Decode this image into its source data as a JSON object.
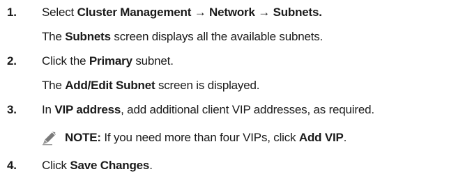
{
  "steps": [
    {
      "number": "1.",
      "main": {
        "prefix": "Select ",
        "path1": "Cluster Management",
        "arrow1": " → ",
        "path2": "Network",
        "arrow2": " → ",
        "path3": "Subnets."
      },
      "result": {
        "prefix": "The ",
        "term": "Subnets",
        "suffix": " screen displays all the available subnets."
      }
    },
    {
      "number": "2.",
      "main": {
        "prefix": "Click the ",
        "term": "Primary",
        "suffix": " subnet."
      },
      "result": {
        "prefix": "The ",
        "term": "Add/Edit Subnet",
        "suffix": " screen is displayed."
      }
    },
    {
      "number": "3.",
      "main": {
        "prefix": "In ",
        "term": "VIP address",
        "suffix": ", add additional client VIP addresses, as required."
      },
      "note": {
        "icon": "pencil-note-icon",
        "label": "NOTE:",
        "text": " If you need more than four VIPs, click ",
        "term": "Add VIP",
        "suffix": "."
      }
    },
    {
      "number": "4.",
      "main": {
        "prefix": "Click ",
        "term": "Save Changes",
        "suffix": "."
      }
    }
  ]
}
